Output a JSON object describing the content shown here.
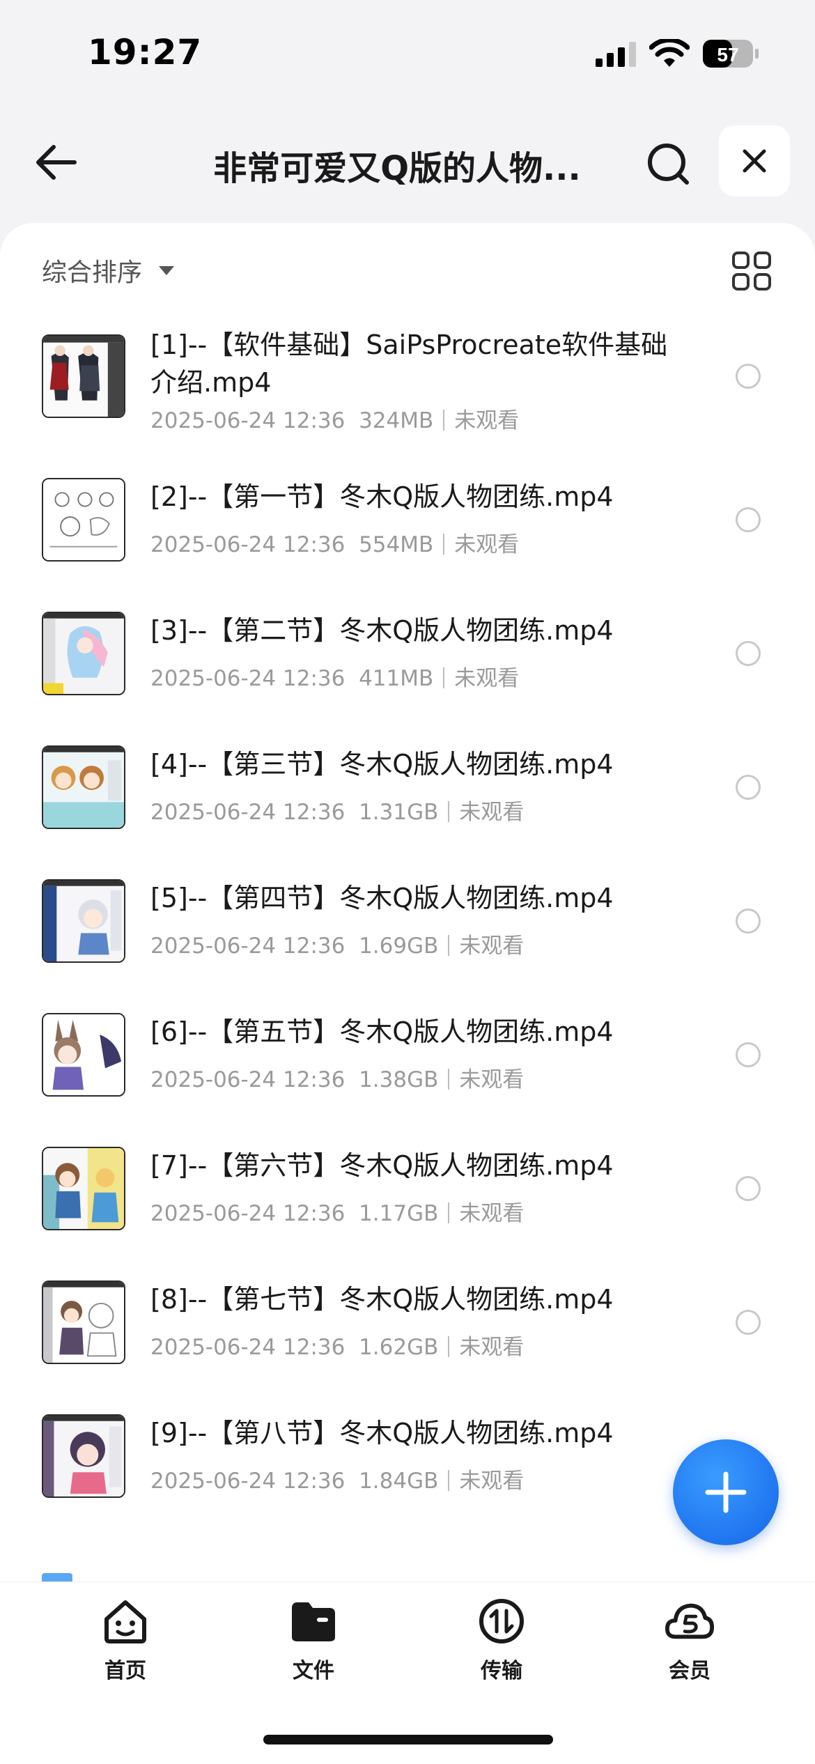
{
  "status_bar": {
    "time": "19:27",
    "battery": "57"
  },
  "header": {
    "title": "非常可爱又Q版的人物..."
  },
  "toolbar": {
    "sort_label": "综合排序"
  },
  "files": [
    {
      "name": "[1]--【软件基础】SaiPsProcreate软件基础介绍.mp4",
      "date": "2025-06-24 12:36",
      "size": "324MB",
      "status": "未观看"
    },
    {
      "name": "[2]--【第一节】冬木Q版人物团练.mp4",
      "date": "2025-06-24 12:36",
      "size": "554MB",
      "status": "未观看"
    },
    {
      "name": "[3]--【第二节】冬木Q版人物团练.mp4",
      "date": "2025-06-24 12:36",
      "size": "411MB",
      "status": "未观看"
    },
    {
      "name": "[4]--【第三节】冬木Q版人物团练.mp4",
      "date": "2025-06-24 12:36",
      "size": "1.31GB",
      "status": "未观看"
    },
    {
      "name": "[5]--【第四节】冬木Q版人物团练.mp4",
      "date": "2025-06-24 12:36",
      "size": "1.69GB",
      "status": "未观看"
    },
    {
      "name": "[6]--【第五节】冬木Q版人物团练.mp4",
      "date": "2025-06-24 12:36",
      "size": "1.38GB",
      "status": "未观看"
    },
    {
      "name": "[7]--【第六节】冬木Q版人物团练.mp4",
      "date": "2025-06-24 12:36",
      "size": "1.17GB",
      "status": "未观看"
    },
    {
      "name": "[8]--【第七节】冬木Q版人物团练.mp4",
      "date": "2025-06-24 12:36",
      "size": "1.62GB",
      "status": "未观看"
    },
    {
      "name": "[9]--【第八节】冬木Q版人物团练.mp4",
      "date": "2025-06-24 12:36",
      "size": "1.84GB",
      "status": "未观看"
    }
  ],
  "tabs": [
    {
      "label": "首页",
      "icon": "smile-face-icon"
    },
    {
      "label": "文件",
      "icon": "folder-icon"
    },
    {
      "label": "传输",
      "icon": "transfer-icon"
    },
    {
      "label": "会员",
      "icon": "cloud-vip-icon"
    }
  ],
  "colors": {
    "accent": "#1a73ff",
    "fab": "#1f7bff",
    "meta": "#9a9a9a"
  }
}
